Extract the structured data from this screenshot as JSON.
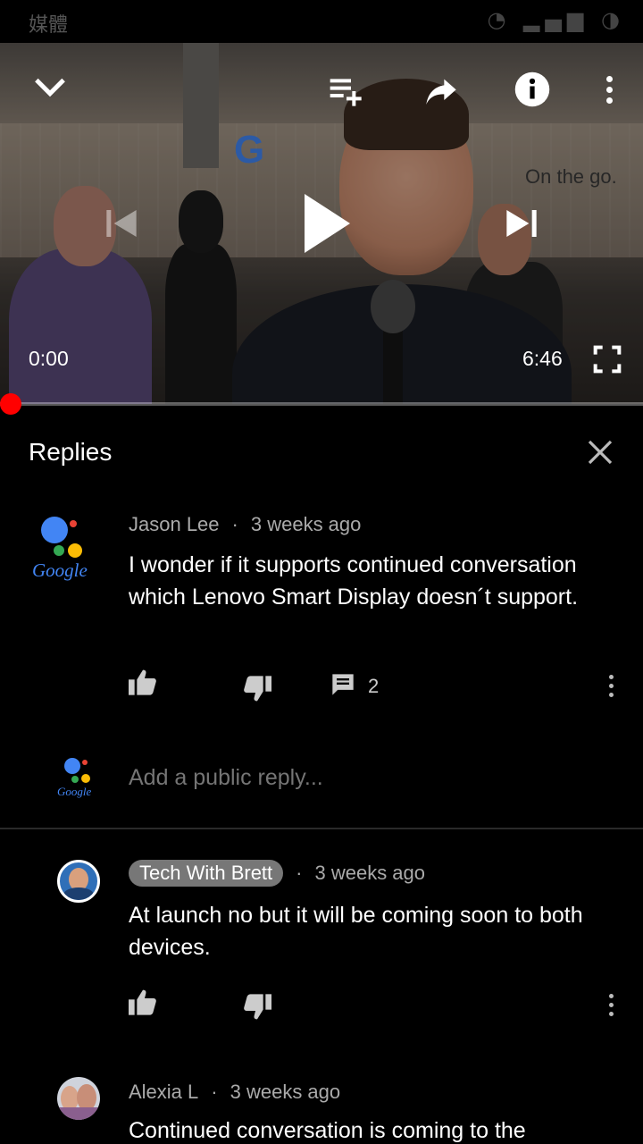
{
  "status_bar": {
    "app_name": "媒體",
    "icons": [
      "wifi-icon",
      "signal-icon",
      "battery-icon"
    ]
  },
  "player": {
    "current_time": "0:00",
    "duration": "6:46",
    "progress": 0.0,
    "scene_sign_text": "On the go.",
    "scene_logo_letter": "G",
    "controls": [
      "collapse-icon",
      "add-to-queue-icon",
      "share-icon",
      "info-icon",
      "more-icon",
      "previous-icon",
      "play-icon",
      "next-icon",
      "fullscreen-icon"
    ]
  },
  "replies_panel": {
    "title": "Replies",
    "parent_comment": {
      "author": "Jason Lee",
      "time": "3 weeks ago",
      "text": "I wonder if it supports continued conversation which Lenovo Smart Display doesn´t support.",
      "reply_count": "2",
      "avatar_word": "Google"
    },
    "add_reply": {
      "placeholder": "Add a public reply...",
      "avatar_word": "Google"
    },
    "replies": [
      {
        "author": "Tech With Brett",
        "time": "3 weeks ago",
        "text": "At launch no but it will be coming soon to both devices.",
        "is_creator": true
      },
      {
        "author": "Alexia L",
        "time": "3 weeks ago",
        "text": "Continued conversation is coming to the"
      }
    ]
  },
  "colors": {
    "progress": "#ff0000",
    "background": "#000000",
    "creator_chip": "#777777"
  }
}
